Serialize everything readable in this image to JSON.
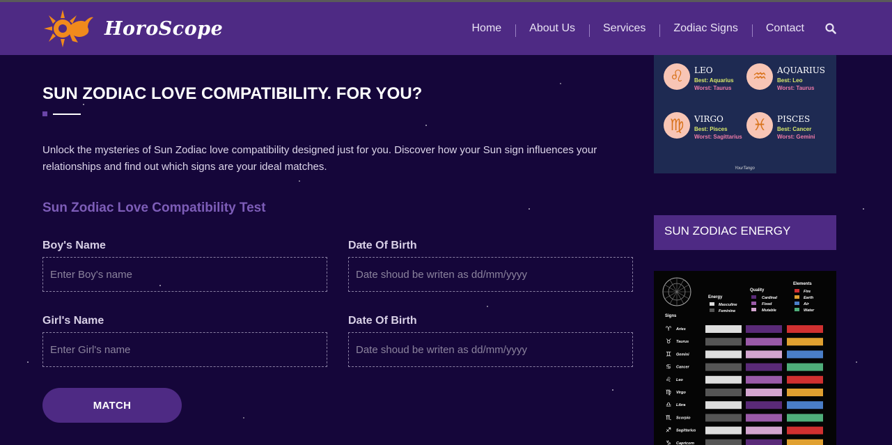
{
  "brand": {
    "name": "HoroScope"
  },
  "nav": {
    "items": [
      {
        "label": "Home"
      },
      {
        "label": "About Us"
      },
      {
        "label": "Services"
      },
      {
        "label": "Zodiac Signs"
      },
      {
        "label": "Contact"
      }
    ]
  },
  "main": {
    "title": "SUN ZODIAC LOVE COMPATIBILITY. FOR YOU?",
    "intro": "Unlock the mysteries of Sun Zodiac love compatibility designed just for you. Discover how your Sun sign influences your relationships and find out which signs are your ideal matches.",
    "test_title": "Sun Zodiac Love Compatibility Test",
    "form": {
      "boy_name_label": "Boy's Name",
      "boy_name_placeholder": "Enter Boy's name",
      "boy_dob_label": "Date Of Birth",
      "boy_dob_placeholder": "Date shoud be writen as dd/mm/yyyy",
      "girl_name_label": "Girl's Name",
      "girl_name_placeholder": "Enter Girl's name",
      "girl_dob_label": "Date Of Birth",
      "girl_dob_placeholder": "Date shoud be writen as dd/mm/yyyy",
      "match_label": "MATCH"
    }
  },
  "sidebar": {
    "compat_card": {
      "signs": [
        {
          "name": "LEO",
          "glyph": "♌",
          "best": "Best: Aquarius",
          "worst": "Worst: Taurus"
        },
        {
          "name": "AQUARIUS",
          "glyph": "♒",
          "best": "Best: Leo",
          "worst": "Worst: Taurus"
        },
        {
          "name": "VIRGO",
          "glyph": "♍",
          "best": "Best: Pisces",
          "worst": "Worst: Sagittarius"
        },
        {
          "name": "PISCES",
          "glyph": "♓",
          "best": "Best: Cancer",
          "worst": "Worst: Gemini"
        }
      ],
      "signature": "YourTango"
    },
    "energy_title": "SUN ZODIAC ENERGY",
    "energy_chart": {
      "legend": {
        "energy_title": "Energy",
        "energy": [
          "Masculine",
          "Feminine"
        ],
        "quality_title": "Quality",
        "quality": [
          "Cardinal",
          "Fixed",
          "Mutable"
        ],
        "elements_title": "Elements",
        "elements": [
          "Fire",
          "Earth",
          "Air",
          "Water"
        ]
      },
      "signs_title": "Signs",
      "colors": {
        "masculine": "#dddddd",
        "feminine": "#555555",
        "cardinal": "#5a2a78",
        "fixed": "#9a5aa8",
        "mutable": "#d3a5cf",
        "fire": "#d03030",
        "earth": "#e0a030",
        "air": "#4a7ec8",
        "water": "#4fae7a"
      },
      "rows": [
        {
          "glyph": "♈",
          "name": "Aries",
          "energy": "masculine",
          "quality": "cardinal",
          "element": "fire"
        },
        {
          "glyph": "♉",
          "name": "Taurus",
          "energy": "feminine",
          "quality": "fixed",
          "element": "earth"
        },
        {
          "glyph": "♊",
          "name": "Gemini",
          "energy": "masculine",
          "quality": "mutable",
          "element": "air"
        },
        {
          "glyph": "♋",
          "name": "Cancer",
          "energy": "feminine",
          "quality": "cardinal",
          "element": "water"
        },
        {
          "glyph": "♌",
          "name": "Leo",
          "energy": "masculine",
          "quality": "fixed",
          "element": "fire"
        },
        {
          "glyph": "♍",
          "name": "Virgo",
          "energy": "feminine",
          "quality": "mutable",
          "element": "earth"
        },
        {
          "glyph": "♎",
          "name": "Libra",
          "energy": "masculine",
          "quality": "cardinal",
          "element": "air"
        },
        {
          "glyph": "♏",
          "name": "Scorpio",
          "energy": "feminine",
          "quality": "fixed",
          "element": "water"
        },
        {
          "glyph": "♐",
          "name": "Sagittarius",
          "energy": "masculine",
          "quality": "mutable",
          "element": "fire"
        },
        {
          "glyph": "♑",
          "name": "Capricorn",
          "energy": "feminine",
          "quality": "cardinal",
          "element": "earth"
        }
      ]
    }
  }
}
